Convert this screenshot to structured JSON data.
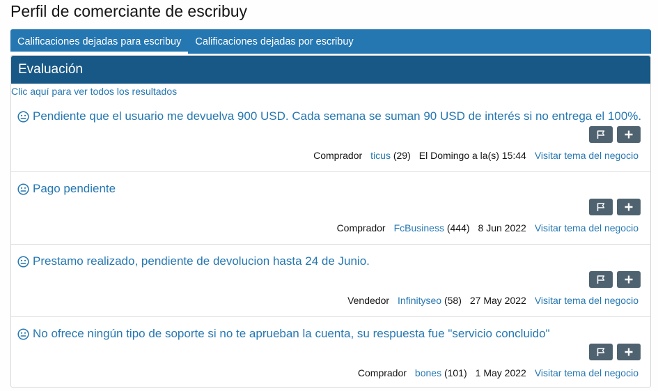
{
  "page": {
    "title": "Perfil de comerciante de escribuy"
  },
  "tabs": [
    {
      "label": "Calificaciones dejadas para escribuy",
      "active": true
    },
    {
      "label": "Calificaciones dejadas por escribuy",
      "active": false
    }
  ],
  "panel": {
    "header": "Evaluación",
    "see_all": "Clic aquí para ver todos los resultados"
  },
  "icons": {
    "sentiment": "neutral-face-icon",
    "report": "flag-icon",
    "more": "plus-icon"
  },
  "colors": {
    "tab_bar": "#2577b1",
    "panel_header": "#185886",
    "link": "#2577b1",
    "action_button": "#4f6270"
  },
  "entries": [
    {
      "text": "Pendiente que el usuario me devuelva 900 USD. Cada semana se suman 90 USD de interés si no entrega el 100%.",
      "role": "Comprador",
      "user": "ticus",
      "count": "(29)",
      "date": "El Domingo a la(s) 15:44",
      "thread_link": "Visitar tema del negocio"
    },
    {
      "text": "Pago pendiente",
      "role": "Comprador",
      "user": "FcBusiness",
      "count": "(444)",
      "date": "8 Jun 2022",
      "thread_link": "Visitar tema del negocio"
    },
    {
      "text": "Prestamo realizado, pendiente de devolucion hasta 24 de Junio.",
      "role": "Vendedor",
      "user": "Infinityseo",
      "count": "(58)",
      "date": "27 May 2022",
      "thread_link": "Visitar tema del negocio"
    },
    {
      "text": "No ofrece ningún tipo de soporte si no te aprueban la cuenta, su respuesta fue \"servicio concluido\"",
      "role": "Comprador",
      "user": "bones",
      "count": "(101)",
      "date": "1 May 2022",
      "thread_link": "Visitar tema del negocio"
    }
  ]
}
